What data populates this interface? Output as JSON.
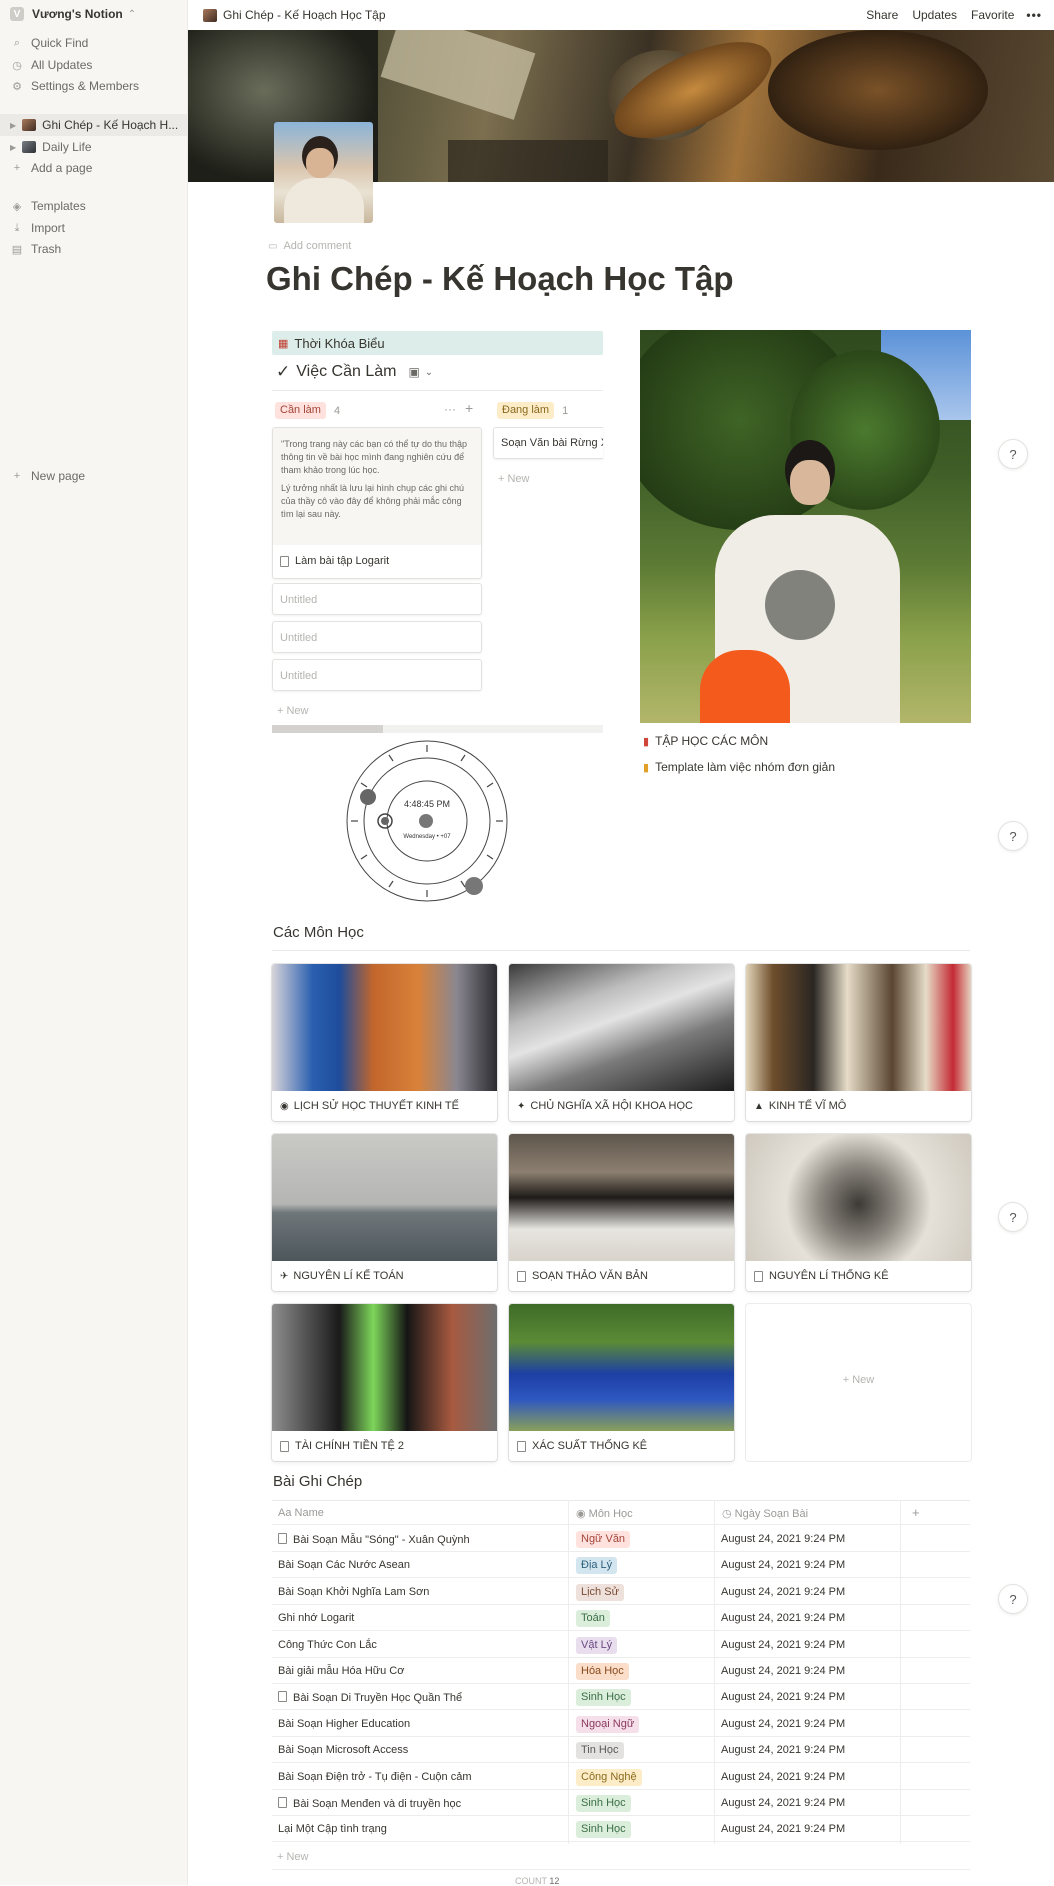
{
  "sidebar": {
    "workspace": "Vương's Notion",
    "workspace_initial": "V",
    "items": [
      {
        "label": "Quick Find",
        "icon": "search-icon"
      },
      {
        "label": "All Updates",
        "icon": "clock-icon"
      },
      {
        "label": "Settings & Members",
        "icon": "gear-icon"
      }
    ],
    "pages": [
      {
        "label": "Ghi Chép - Kế Hoạch H..."
      },
      {
        "label": "Daily Life"
      }
    ],
    "add_page": "Add a page",
    "tools": [
      {
        "label": "Templates",
        "icon": "templates-icon"
      },
      {
        "label": "Import",
        "icon": "import-icon"
      },
      {
        "label": "Trash",
        "icon": "trash-icon"
      }
    ],
    "new_page": "New page"
  },
  "topbar": {
    "breadcrumb": "Ghi Chép - Kế Hoạch Học Tập",
    "share": "Share",
    "updates": "Updates",
    "favorite": "Favorite",
    "more": "•••"
  },
  "page": {
    "add_comment": "Add comment",
    "title": "Ghi Chép - Kế Hoạch Học Tập"
  },
  "left_col": {
    "callout": "Thời Khóa Biểu",
    "board_title": "Việc Cần Làm",
    "groups": [
      {
        "tag": "Cần làm",
        "count": "4",
        "tag_color": "#ffe2dd",
        "text_color": "#a3453a"
      },
      {
        "tag": "Đang làm",
        "count": "1",
        "tag_color": "#fdecc8",
        "text_color": "#8a6a1e"
      }
    ],
    "note_lines": [
      "\"Trong trang này các bạn có thể tự do thu thập thông tin về bài học mình đang nghiên cứu để tham khảo trong lúc học.",
      "Lý tưởng nhất là lưu lại hình chụp các ghi chú của thầy cô vào đây để không phải mắc công tìm lại sau này."
    ],
    "note_card_title": "Làm bài tập Logarit",
    "untitled": [
      "Untitled",
      "Untitled",
      "Untitled"
    ],
    "new": "New",
    "doing_card": "Soạn Văn bài Rừng X",
    "new2": "New"
  },
  "clock": {
    "time": "4:48:45 PM",
    "date": "Wednesday • +07"
  },
  "right_col": {
    "links": [
      {
        "icon": "flag-icon",
        "label": "TẬP HỌC CÁC MÔN"
      },
      {
        "icon": "notebook-icon",
        "label": "Template làm việc nhóm đơn giản"
      }
    ]
  },
  "subjects": {
    "heading": "Các Môn Học",
    "cards": [
      {
        "title": "LỊCH SỬ HỌC THUYẾT KINH TẾ",
        "icon": "sushi-icon"
      },
      {
        "title": "CHỦ NGHĨA XÃ HỘI KHOA HỌC",
        "icon": "dancer-icon"
      },
      {
        "title": "KINH TẾ VĨ MÔ",
        "icon": "chart-icon"
      },
      {
        "title": "NGUYÊN LÍ KẾ TOÁN",
        "icon": "plane-icon"
      },
      {
        "title": "SOẠN THẢO VĂN BẢN",
        "icon": "document-icon"
      },
      {
        "title": "NGUYÊN LÍ THỐNG KÊ",
        "icon": "document-icon"
      },
      {
        "title": "TÀI CHÍNH TIỀN TỆ 2",
        "icon": "document-icon"
      },
      {
        "title": "XÁC SUẤT THỐNG KÊ",
        "icon": "document-icon"
      }
    ],
    "new": "New"
  },
  "notes": {
    "heading": "Bài Ghi Chép",
    "columns": [
      "Name",
      "Môn Học",
      "Ngày Soạn Bài"
    ],
    "rows": [
      {
        "name": "Bài Soạn Mẫu \"Sóng\" - Xuân Quỳnh",
        "doc": true,
        "subject": "Ngữ Văn",
        "bg": "#ffe2dd",
        "fg": "#a3453a",
        "date": "August 24, 2021 9:24 PM"
      },
      {
        "name": "Bài Soạn Các Nước Asean",
        "doc": false,
        "subject": "Địa Lý",
        "bg": "#d3e5ef",
        "fg": "#2d5f7d",
        "date": "August 24, 2021 9:24 PM"
      },
      {
        "name": "Bài Soạn Khởi Nghĩa Lam Sơn",
        "doc": false,
        "subject": "Lịch Sử",
        "bg": "#eee0da",
        "fg": "#7a4d36",
        "date": "August 24, 2021 9:24 PM"
      },
      {
        "name": "Ghi nhớ Logarit",
        "doc": false,
        "subject": "Toán",
        "bg": "#dbeddb",
        "fg": "#3b6e46",
        "date": "August 24, 2021 9:24 PM"
      },
      {
        "name": "Công Thức Con Lắc",
        "doc": false,
        "subject": "Vật Lý",
        "bg": "#e8deee",
        "fg": "#6a4a82",
        "date": "August 24, 2021 9:24 PM"
      },
      {
        "name": "Bài giải mẫu Hóa Hữu Cơ",
        "doc": false,
        "subject": "Hóa Học",
        "bg": "#fadec9",
        "fg": "#8a4a1e",
        "date": "August 24, 2021 9:24 PM"
      },
      {
        "name": "Bài Soạn Di Truyền Học Quần Thể",
        "doc": true,
        "subject": "Sinh Học",
        "bg": "#dbeddb",
        "fg": "#3b6e46",
        "date": "August 24, 2021 9:24 PM"
      },
      {
        "name": "Bài Soạn Higher Education",
        "doc": false,
        "subject": "Ngoại Ngữ",
        "bg": "#f5e0e9",
        "fg": "#8a3a60",
        "date": "August 24, 2021 9:24 PM"
      },
      {
        "name": "Bài Soạn Microsoft Access",
        "doc": false,
        "subject": "Tin Học",
        "bg": "#e3e2e0",
        "fg": "#5a5955",
        "date": "August 24, 2021 9:24 PM"
      },
      {
        "name": "Bài Soạn Điện trở - Tụ điện - Cuộn cảm",
        "doc": false,
        "subject": "Công Nghệ",
        "bg": "#fdecc8",
        "fg": "#8a6a1e",
        "date": "August 24, 2021 9:24 PM"
      },
      {
        "name": "Bài Soạn Menđen và di truyền học",
        "doc": true,
        "subject": "Sinh Học",
        "bg": "#dbeddb",
        "fg": "#3b6e46",
        "date": "August 24, 2021 9:24 PM"
      },
      {
        "name": "Lại Một Cập tình trạng",
        "doc": false,
        "subject": "Sinh Học",
        "bg": "#dbeddb",
        "fg": "#3b6e46",
        "date": "August 24, 2021 9:24 PM"
      }
    ],
    "new": "New",
    "count_label": "COUNT",
    "count": "12"
  },
  "help": "?"
}
